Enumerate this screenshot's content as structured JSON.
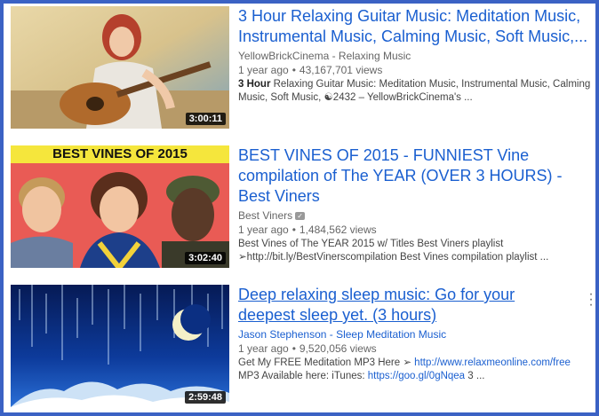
{
  "results": [
    {
      "title": "3 Hour Relaxing Guitar Music: Meditation Music, Instrumental Music, Calming Music, Soft Music,...",
      "channel": "YellowBrickCinema - Relaxing Music",
      "age": "1 year ago",
      "views": "43,167,701 views",
      "desc_bold": "3 Hour",
      "desc_rest": " Relaxing Guitar Music: Meditation Music, Instrumental Music, Calming Music, Soft Music, ☯2432 – YellowBrickCinema's ...",
      "duration": "3:00:11",
      "verified": false
    },
    {
      "title": "BEST VINES OF 2015 - FUNNIEST Vine compilation of The YEAR (OVER 3 HOURS) - Best Viners",
      "channel": "Best Viners",
      "age": "1 year ago",
      "views": "1,484,562 views",
      "desc_line1": "Best Vines of The YEAR 2015 w/ Titles Best Viners playlist",
      "desc_line2": "➢http://bit.ly/BestVinerscompilation Best Vines compilation playlist ...",
      "duration": "3:02:40",
      "thumb_banner": "BEST VINES OF 2015",
      "verified": true
    },
    {
      "title": "Deep relaxing sleep music: Go for your deepest sleep yet. (3 hours)",
      "channel": "Jason Stephenson - Sleep Meditation Music",
      "age": "1 year ago",
      "views": "9,520,056 views",
      "desc_prefix": "Get My FREE Meditation MP3 Here ➢ ",
      "desc_link1": "http://www.relaxmeonline.com/free",
      "desc_mid": "MP3 Available here: iTunes: ",
      "desc_link2": "https://goo.gl/0gNqea",
      "desc_suffix": " 3 ...",
      "duration": "2:59:48",
      "verified": false
    }
  ],
  "icons": {
    "separator": "•",
    "kebab": "more-vert-icon"
  },
  "colors": {
    "frame": "#3b62c4",
    "title_link": "#1a5fd0",
    "meta": "#666666"
  }
}
